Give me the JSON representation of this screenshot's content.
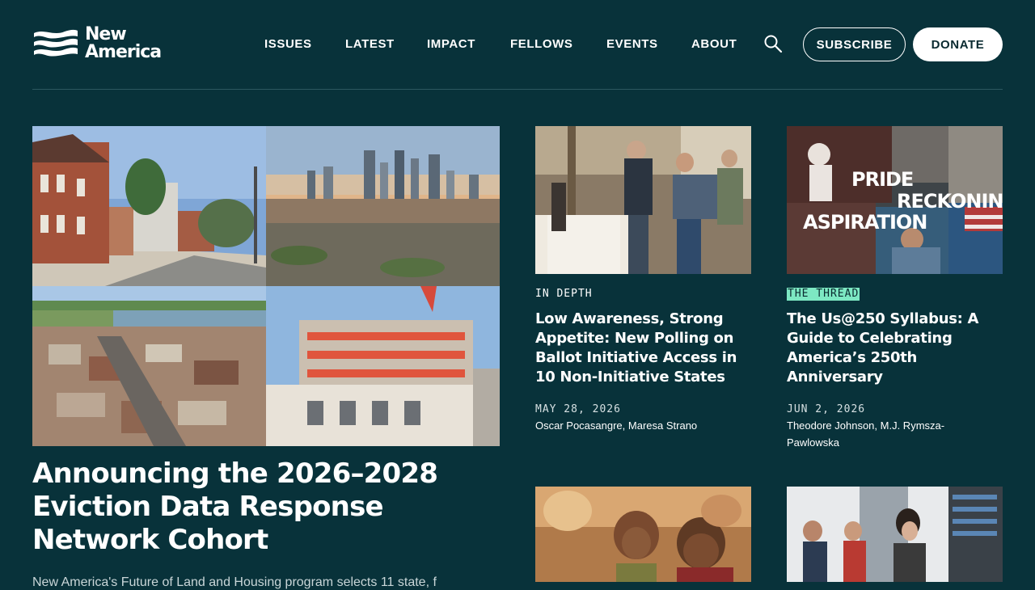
{
  "brand": {
    "name_line1": "New",
    "name_line2": "America"
  },
  "nav": {
    "items": [
      "ISSUES",
      "LATEST",
      "IMPACT",
      "FELLOWS",
      "EVENTS",
      "ABOUT"
    ],
    "subscribe_label": "SUBSCRIBE",
    "donate_label": "DONATE"
  },
  "hero": {
    "title": "Announcing the 2026–2028 Eviction Data Response Network Cohort",
    "description": "New America's Future of Land and Housing program selects 11 state, f"
  },
  "cards": [
    {
      "label": "IN DEPTH",
      "title": "Low Awareness, Strong Appetite: New Polling on Ballot Initiative Access in 10 Non-Initiative States",
      "date": "MAY 28, 2026",
      "authors": "Oscar Pocasangre, Maresa Strano"
    },
    {
      "label": "THE THREAD",
      "title": "The Us@250 Syllabus: A Guide to Celebrating America’s 250th Anniversary",
      "date": "JUN 2, 2026",
      "authors": "Theodore Johnson, M.J. Rymsza-Pawlowska",
      "image_words": [
        "PRIDE",
        "RECKONING",
        "ASPIRATION"
      ]
    }
  ],
  "colors": {
    "background": "#08323a",
    "thread_highlight": "#7de8c3",
    "donate_bg": "#ffffff"
  },
  "icons": [
    "logo-flag-icon",
    "search-icon"
  ]
}
